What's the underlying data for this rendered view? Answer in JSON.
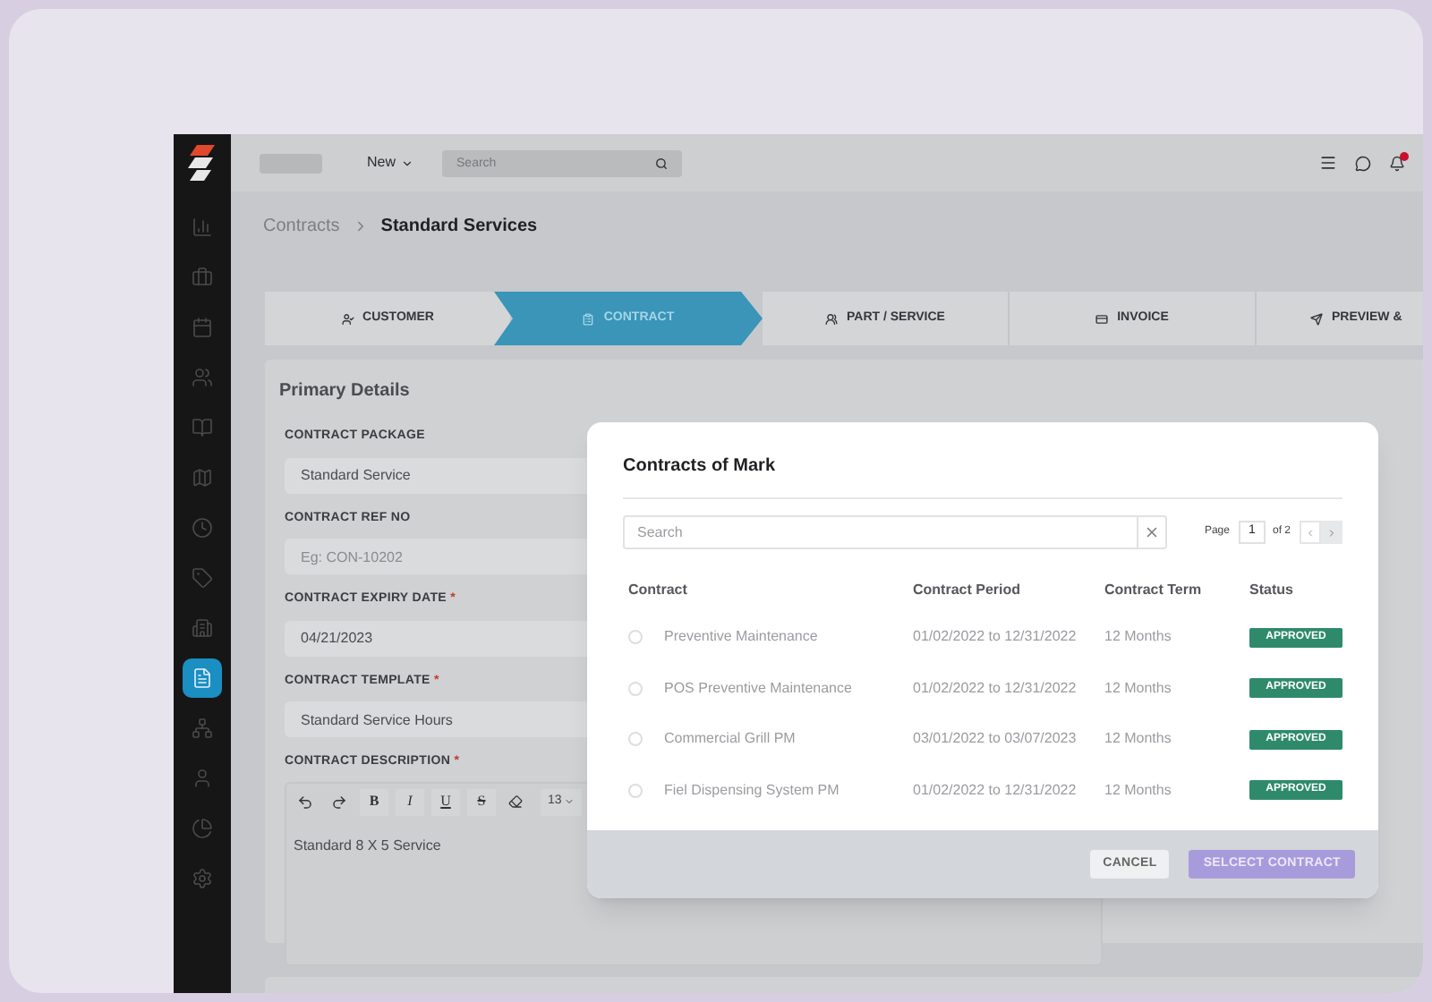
{
  "sidebar": {
    "items": [
      {
        "kind": "chart",
        "selected": false
      },
      {
        "kind": "briefcase",
        "selected": false
      },
      {
        "kind": "calendar",
        "selected": false
      },
      {
        "kind": "users",
        "selected": false
      },
      {
        "kind": "book",
        "selected": false
      },
      {
        "kind": "map",
        "selected": false
      },
      {
        "kind": "clock",
        "selected": false
      },
      {
        "kind": "tag",
        "selected": false
      },
      {
        "kind": "building",
        "selected": false
      },
      {
        "kind": "document",
        "selected": true
      },
      {
        "kind": "network",
        "selected": false
      },
      {
        "kind": "user",
        "selected": false
      },
      {
        "kind": "pie",
        "selected": false
      },
      {
        "kind": "settings",
        "selected": false
      }
    ]
  },
  "topbar": {
    "new_menu": "New",
    "search": {
      "placeholder": "Search"
    },
    "notification_badge": true
  },
  "breadcrumb": {
    "parent": "Contracts",
    "current": "Standard Services"
  },
  "steps": [
    {
      "label": "CUSTOMER",
      "kind": "customer",
      "selected": false
    },
    {
      "label": "CONTRACT",
      "kind": "contract",
      "selected": true
    },
    {
      "label": "PART / SERVICE",
      "kind": "part",
      "selected": false
    },
    {
      "label": "INVOICE",
      "kind": "invoice",
      "selected": false
    },
    {
      "label": "PREVIEW &",
      "kind": "preview",
      "selected": false
    }
  ],
  "form": {
    "title": "Primary Details",
    "fields": [
      {
        "label": "CONTRACT PACKAGE",
        "value": "Standard Service"
      },
      {
        "label": "CONTRACT REF NO",
        "placeholder": "Eg: CON-10202"
      },
      {
        "label": "CONTRACT EXPIRY DATE",
        "required_mark": "*",
        "value": "04/21/2023"
      },
      {
        "label": "CONTRACT TEMPLATE",
        "required_mark": "*",
        "value": "Standard Service Hours"
      }
    ],
    "description": {
      "label": "CONTRACT DESCRIPTION",
      "required_mark": "*",
      "toolbar": [
        "B",
        "I",
        "U",
        "S"
      ],
      "font_size": "13",
      "value": "Standard 8 X 5 Service"
    }
  },
  "modal": {
    "title": "Contracts of Mark",
    "search": {
      "placeholder": "Search"
    },
    "pagination": {
      "label": "Page",
      "page": "1",
      "of": "of 2"
    },
    "columns": [
      "Contract",
      "Contract Period",
      "Contract Term",
      "Status"
    ],
    "rows": [
      {
        "selected": false,
        "contract": "Preventive Maintenance",
        "period": "01/02/2022 to 12/31/2022",
        "term": "12 Months",
        "status": "APPROVED",
        "color": "#2f8a6c"
      },
      {
        "selected": false,
        "contract": "POS Preventive Maintenance",
        "period": "01/02/2022 to 12/31/2022",
        "term": "12 Months",
        "status": "APPROVED",
        "color": "#2f8a6c"
      },
      {
        "selected": false,
        "contract": "Commercial Grill PM",
        "period": "03/01/2022 to 03/07/2023",
        "term": "12 Months",
        "status": "APPROVED",
        "color": "#2f8a6c"
      },
      {
        "selected": false,
        "contract": "Fiel Dispensing System PM",
        "period": "01/02/2022 to 12/31/2022",
        "term": "12 Months",
        "status": "APPROVED",
        "color": "#2f8a6c"
      }
    ],
    "buttons": {
      "cancel": "CANCEL",
      "confirm": "SELCECT CONTRACT"
    }
  }
}
